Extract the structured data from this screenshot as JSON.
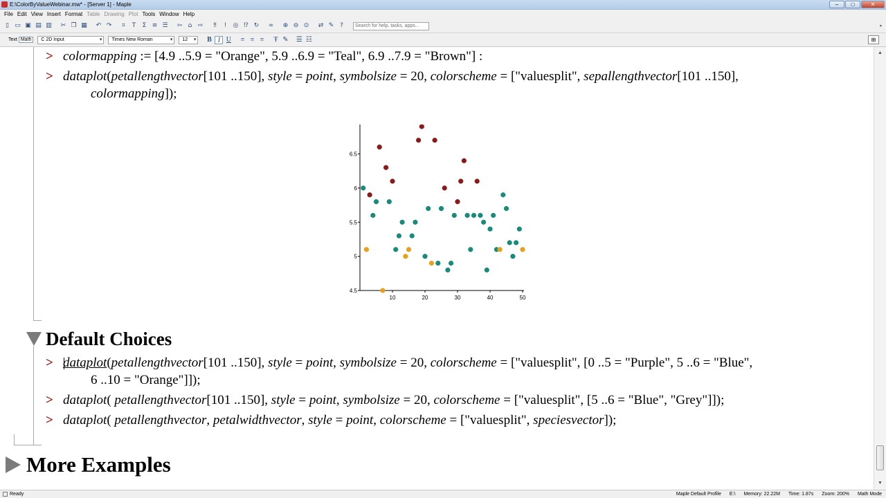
{
  "window": {
    "title": "E:\\ColorByValueWebinar.mw* - [Server 1] - Maple",
    "buttons": [
      "–",
      "□",
      "✕"
    ]
  },
  "menu": [
    {
      "label": "File",
      "enabled": true
    },
    {
      "label": "Edit",
      "enabled": true
    },
    {
      "label": "View",
      "enabled": true
    },
    {
      "label": "Insert",
      "enabled": true
    },
    {
      "label": "Format",
      "enabled": true
    },
    {
      "label": "Table",
      "enabled": false
    },
    {
      "label": "Drawing",
      "enabled": false
    },
    {
      "label": "Plot",
      "enabled": false
    },
    {
      "label": "Tools",
      "enabled": true
    },
    {
      "label": "Window",
      "enabled": true
    },
    {
      "label": "Help",
      "enabled": true
    }
  ],
  "toolbar": {
    "search_placeholder": "Search for help, tasks, apps..."
  },
  "format_bar": {
    "text_mode": "Text",
    "math_mode": "Math",
    "style": "C  2D Input",
    "font": "Times New Roman",
    "size": "12"
  },
  "doc": {
    "line1": {
      "prompt": ">",
      "name": "colormapping",
      "rest": " := [4.9 ..5.9 = \"Orange\", 5.9 ..6.9 = \"Teal\", 6.9 ..7.9 = \"Brown\"] :"
    },
    "line2": {
      "prompt": ">",
      "a": "dataplot",
      "b": "(",
      "c": "petallengthvector",
      "d": "[101 ..150], ",
      "e": "style",
      "f": " = ",
      "g": "point",
      "h": ", ",
      "i": "symbolsize",
      "j": " = 20, ",
      "k": "colorscheme",
      "l": " = [\"valuesplit\", ",
      "m": "sepallengthvector",
      "n": "[101 ..150],",
      "cont_name": "colormapping",
      "cont_rest": "]);"
    },
    "section1": "Default Choices",
    "line3": {
      "prompt": ">",
      "a": "dataplot",
      "b": "(",
      "c": "petallengthvector",
      "d": "[101 ..150], ",
      "e": "style",
      "f": " = ",
      "g": "point",
      "h": ", ",
      "i": "symbolsize",
      "j": " = 20, ",
      "k": "colorscheme",
      "l": " = [\"valuesplit\", [0 ..5 = \"Purple\", 5 ..6 = \"Blue\",",
      "cont": "6 ..10 = \"Orange\"]]);"
    },
    "line4": {
      "prompt": ">",
      "a": "dataplot",
      "b": "( ",
      "c": "petallengthvector",
      "d": "[101 ..150], ",
      "e": "style",
      "f": " = ",
      "g": "point",
      "h": ", ",
      "i": "symbolsize",
      "j": " = 20, ",
      "k": "colorscheme",
      "l": " = [\"valuesplit\", [5 ..6 = \"Blue\", \"Grey\"]]);"
    },
    "line5": {
      "prompt": ">",
      "a": "dataplot",
      "b": "( ",
      "c": "petallengthvector",
      "d": ", ",
      "e": "petalwidthvector",
      "f": ", ",
      "g": "style",
      "h": " = ",
      "i": "point",
      "j": ", ",
      "k": "colorscheme",
      "l": " = [\"valuesplit\", ",
      "m": "speciesvector",
      "n": "]);"
    },
    "section2": "More Examples"
  },
  "status": {
    "left": "Ready",
    "profile": "Maple Default Profile",
    "drive": "E:\\",
    "memory": "Memory: 22.22M",
    "time": "Time: 1.87s",
    "zoom": "Zoom: 200%",
    "mode": "Math Mode"
  },
  "chart_data": {
    "type": "scatter",
    "xlim": [
      0,
      50
    ],
    "ylim": [
      4.5,
      6.9
    ],
    "xticks": [
      10,
      20,
      30,
      40,
      50
    ],
    "yticks": [
      4.5,
      5,
      5.5,
      6,
      6.5
    ],
    "colors": {
      "orange": "#e8a020",
      "teal": "#1a8a7a",
      "brown": "#8b1a1a"
    },
    "points": [
      {
        "x": 1,
        "y": 6.0,
        "c": "teal"
      },
      {
        "x": 2,
        "y": 5.1,
        "c": "orange"
      },
      {
        "x": 3,
        "y": 5.9,
        "c": "brown"
      },
      {
        "x": 4,
        "y": 5.6,
        "c": "teal"
      },
      {
        "x": 5,
        "y": 5.8,
        "c": "teal"
      },
      {
        "x": 6,
        "y": 6.6,
        "c": "brown"
      },
      {
        "x": 7,
        "y": 4.5,
        "c": "orange"
      },
      {
        "x": 8,
        "y": 6.3,
        "c": "brown"
      },
      {
        "x": 9,
        "y": 5.8,
        "c": "teal"
      },
      {
        "x": 10,
        "y": 6.1,
        "c": "brown"
      },
      {
        "x": 11,
        "y": 5.1,
        "c": "teal"
      },
      {
        "x": 12,
        "y": 5.3,
        "c": "teal"
      },
      {
        "x": 13,
        "y": 5.5,
        "c": "teal"
      },
      {
        "x": 14,
        "y": 5.0,
        "c": "orange"
      },
      {
        "x": 15,
        "y": 5.1,
        "c": "orange"
      },
      {
        "x": 16,
        "y": 5.3,
        "c": "teal"
      },
      {
        "x": 17,
        "y": 5.5,
        "c": "teal"
      },
      {
        "x": 18,
        "y": 6.7,
        "c": "brown"
      },
      {
        "x": 19,
        "y": 6.9,
        "c": "brown"
      },
      {
        "x": 20,
        "y": 5.0,
        "c": "teal"
      },
      {
        "x": 21,
        "y": 5.7,
        "c": "teal"
      },
      {
        "x": 22,
        "y": 4.9,
        "c": "orange"
      },
      {
        "x": 23,
        "y": 6.7,
        "c": "brown"
      },
      {
        "x": 24,
        "y": 4.9,
        "c": "teal"
      },
      {
        "x": 25,
        "y": 5.7,
        "c": "teal"
      },
      {
        "x": 26,
        "y": 6.0,
        "c": "brown"
      },
      {
        "x": 27,
        "y": 4.8,
        "c": "teal"
      },
      {
        "x": 28,
        "y": 4.9,
        "c": "teal"
      },
      {
        "x": 29,
        "y": 5.6,
        "c": "teal"
      },
      {
        "x": 30,
        "y": 5.8,
        "c": "brown"
      },
      {
        "x": 31,
        "y": 6.1,
        "c": "brown"
      },
      {
        "x": 32,
        "y": 6.4,
        "c": "brown"
      },
      {
        "x": 33,
        "y": 5.6,
        "c": "teal"
      },
      {
        "x": 34,
        "y": 5.1,
        "c": "teal"
      },
      {
        "x": 35,
        "y": 5.6,
        "c": "teal"
      },
      {
        "x": 36,
        "y": 6.1,
        "c": "brown"
      },
      {
        "x": 37,
        "y": 5.6,
        "c": "teal"
      },
      {
        "x": 38,
        "y": 5.5,
        "c": "teal"
      },
      {
        "x": 39,
        "y": 4.8,
        "c": "teal"
      },
      {
        "x": 40,
        "y": 5.4,
        "c": "teal"
      },
      {
        "x": 41,
        "y": 5.6,
        "c": "teal"
      },
      {
        "x": 42,
        "y": 5.1,
        "c": "teal"
      },
      {
        "x": 43,
        "y": 5.1,
        "c": "orange"
      },
      {
        "x": 44,
        "y": 5.9,
        "c": "teal"
      },
      {
        "x": 45,
        "y": 5.7,
        "c": "teal"
      },
      {
        "x": 46,
        "y": 5.2,
        "c": "teal"
      },
      {
        "x": 47,
        "y": 5.0,
        "c": "teal"
      },
      {
        "x": 48,
        "y": 5.2,
        "c": "teal"
      },
      {
        "x": 49,
        "y": 5.4,
        "c": "teal"
      },
      {
        "x": 50,
        "y": 5.1,
        "c": "orange"
      }
    ]
  }
}
